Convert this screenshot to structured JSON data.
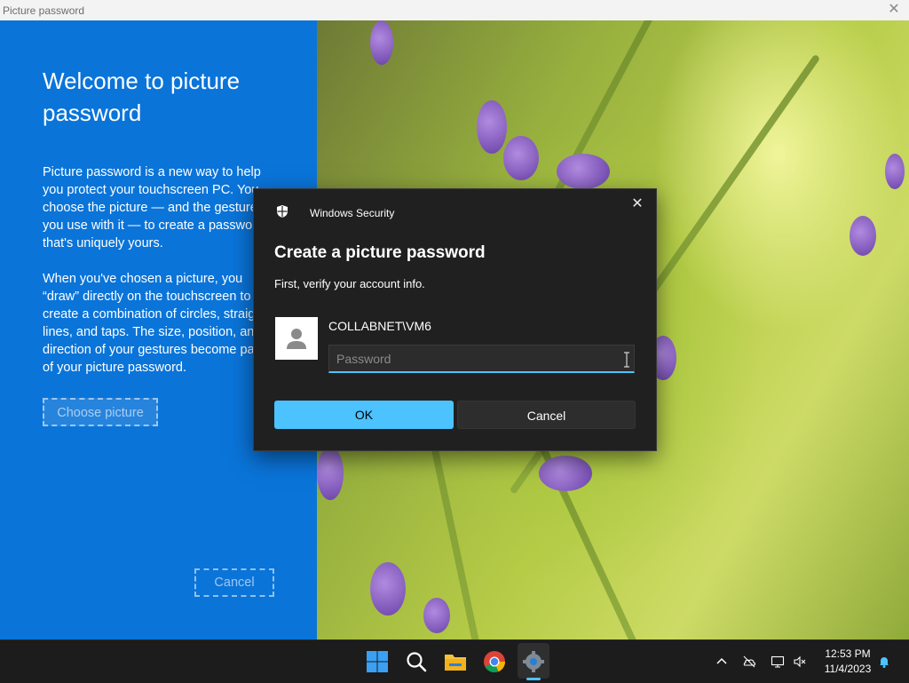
{
  "window": {
    "title": "Picture password"
  },
  "left_panel": {
    "heading": "Welcome to picture password",
    "paragraph1_lines": [
      "Picture password is a new way to help",
      "you protect your touchscreen PC. You",
      "choose the picture — and the gestures",
      "you use with it — to create a password",
      "that's uniquely yours."
    ],
    "paragraph2_lines": [
      "When you've chosen a picture, you",
      "“draw” directly on the touchscreen to",
      "create a combination of circles, straight",
      "lines, and taps. The size, position, and",
      "direction of your gestures become part",
      "of your picture password."
    ],
    "choose_button": "Choose picture",
    "cancel_button": "Cancel"
  },
  "dialog": {
    "app_name": "Windows Security",
    "title": "Create a picture password",
    "subtitle": "First, verify your account info.",
    "account_name": "COLLABNET\\VM6",
    "password_placeholder": "Password",
    "password_value": "",
    "ok_button": "OK",
    "cancel_button": "Cancel"
  },
  "taskbar": {
    "apps": [
      "windows-start",
      "search",
      "file-explorer",
      "chrome",
      "settings"
    ],
    "active_app": "settings",
    "clock_time": "12:53 PM",
    "clock_date": "11/4/2023"
  },
  "colors": {
    "left_panel_blue": "#0a74d9",
    "dialog_bg": "#202020",
    "accent": "#4cc2ff",
    "taskbar_bg": "#1c1c1c"
  }
}
